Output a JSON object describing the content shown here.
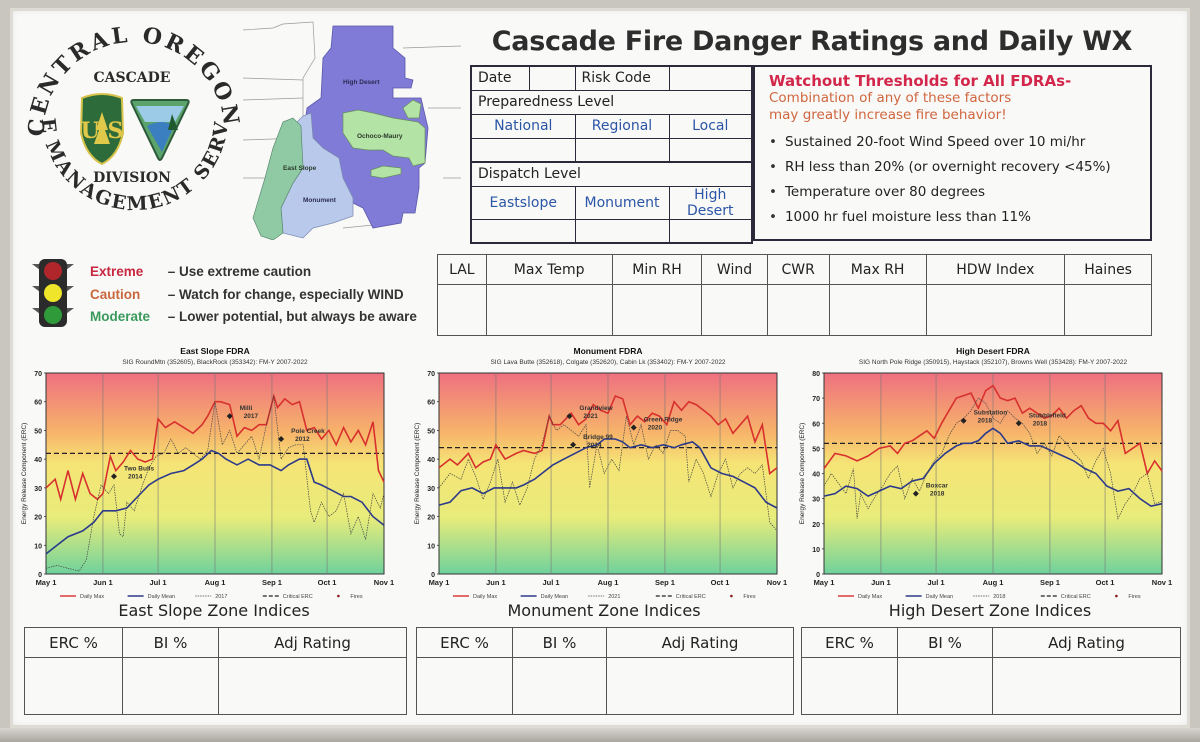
{
  "title": "Cascade Fire Danger Ratings and Daily WX",
  "logo": {
    "arc_top": "CENTRAL OREGON",
    "arc_bottom": "FIRE MANAGEMENT SERVICE",
    "line1": "CASCADE",
    "line2": "DIVISION",
    "usfs_badge": "FOREST SERVICE",
    "usfs_letters": "USFS",
    "blm_badge": "BUREAU OF LAND MANAGEMENT"
  },
  "map": {
    "regions": [
      {
        "name": "High Desert",
        "color": "#7d79d4"
      },
      {
        "name": "Ochoco-Maury",
        "color": "#b4e0a8"
      },
      {
        "name": "East Slope",
        "color": "#8ec9a4"
      },
      {
        "name": "Monument",
        "color": "#b7c8ea"
      }
    ]
  },
  "status_table": {
    "date_label": "Date",
    "date_value": "",
    "risk_code_label": "Risk Code",
    "risk_code_value": "",
    "preparedness_label": "Preparedness Level",
    "preparedness_cols": [
      "National",
      "Regional",
      "Local"
    ],
    "preparedness_values": [
      "",
      "",
      ""
    ],
    "dispatch_label": "Dispatch Level",
    "dispatch_cols": [
      "Eastslope",
      "Monument",
      "High Desert"
    ],
    "dispatch_values": [
      "",
      "",
      ""
    ]
  },
  "watchout": {
    "heading": "Watchout Thresholds for All FDRAs-",
    "subheading_1": "Combination of any of these factors",
    "subheading_2": "may greatly increase fire behavior!",
    "items": [
      "Sustained 20-foot Wind Speed over 10 mi/hr",
      "RH less than 20% (or overnight recovery <45%)",
      "Temperature over 80 degrees",
      "1000 hr fuel moisture less than 11%"
    ]
  },
  "legend": {
    "items": [
      {
        "level": "Extreme",
        "desc": "– Use extreme caution",
        "color": "#c8283f"
      },
      {
        "level": "Caution",
        "desc": "– Watch for change, especially WIND",
        "color": "#c9683d"
      },
      {
        "level": "Moderate",
        "desc": "– Lower potential, but always be aware",
        "color": "#3a9a5c"
      }
    ]
  },
  "wx_table": {
    "columns": [
      "LAL",
      "Max Temp",
      "Min RH",
      "Wind",
      "CWR",
      "Max RH",
      "HDW Index",
      "Haines"
    ],
    "values": [
      "",
      "",
      "",
      "",
      "",
      "",
      "",
      ""
    ]
  },
  "zones": [
    {
      "title": "East Slope Zone Indices",
      "columns": [
        "ERC %",
        "BI %",
        "Adj Rating"
      ],
      "values": [
        "",
        "",
        ""
      ]
    },
    {
      "title": "Monument Zone Indices",
      "columns": [
        "ERC %",
        "BI %",
        "Adj Rating"
      ],
      "values": [
        "",
        "",
        ""
      ]
    },
    {
      "title": "High Desert Zone Indices",
      "columns": [
        "ERC %",
        "BI %",
        "Adj Rating"
      ],
      "values": [
        "",
        "",
        ""
      ]
    }
  ],
  "chart_colors": {
    "daily_max": "#d8302e",
    "daily_mean": "#2c3a8c",
    "year": "#444444",
    "critical": "#222222"
  },
  "chart_data": [
    {
      "type": "line",
      "title": "East Slope FDRA",
      "subtitle": "SIG RoundMtn (352605), BlackRock (353342): FM-Y  2007-2022",
      "xlabel": "",
      "ylabel": "Energy Release Component (ERC)",
      "x_ticks": [
        "May 1",
        "Jun 1",
        "Jul 1",
        "Aug 1",
        "Sep 1",
        "Oct 1",
        "Nov 1"
      ],
      "x_range_days": [
        0,
        184
      ],
      "ylim": [
        0,
        70
      ],
      "y_ticks": [
        0,
        10,
        20,
        30,
        40,
        50,
        60,
        70
      ],
      "grid": "vertical at month starts",
      "legend": [
        "Daily Max",
        "Daily Mean",
        "2017",
        "Critical ERC",
        "Fires"
      ],
      "legend_placement": "bottom",
      "critical_erc": 42,
      "series": [
        {
          "name": "Daily Max",
          "x": [
            0,
            5,
            8,
            12,
            16,
            20,
            24,
            28,
            31,
            35,
            38,
            42,
            46,
            50,
            54,
            58,
            61,
            65,
            70,
            75,
            80,
            85,
            88,
            92,
            95,
            100,
            104,
            108,
            112,
            116,
            120,
            124,
            126,
            130,
            134,
            138,
            142,
            146,
            150,
            154,
            158,
            162,
            166,
            170,
            174,
            178,
            181,
            184
          ],
          "values": [
            30,
            33,
            26,
            36,
            26,
            35,
            28,
            26,
            28,
            41,
            36,
            39,
            43,
            40,
            39,
            40,
            54,
            51,
            53,
            51,
            49,
            52,
            55,
            60,
            60,
            59,
            48,
            51,
            50,
            52,
            52,
            62,
            58,
            61,
            59,
            60,
            50,
            51,
            47,
            50,
            45,
            51,
            46,
            50,
            45,
            53,
            36,
            32
          ]
        },
        {
          "name": "Daily Mean",
          "x": [
            0,
            6,
            12,
            20,
            26,
            31,
            38,
            44,
            50,
            56,
            61,
            68,
            75,
            80,
            85,
            90,
            94,
            98,
            104,
            110,
            116,
            122,
            128,
            132,
            138,
            142,
            146,
            150,
            156,
            162,
            166,
            172,
            178,
            184
          ],
          "values": [
            7,
            10,
            13,
            15,
            18,
            22,
            22,
            23,
            27,
            31,
            33,
            35,
            36,
            38,
            40,
            43,
            42,
            40,
            38,
            40,
            38,
            38,
            36,
            38,
            40,
            40,
            32,
            31,
            29,
            27,
            27,
            25,
            20,
            17
          ]
        },
        {
          "name": "2017",
          "x": [
            0,
            6,
            12,
            18,
            22,
            26,
            30,
            34,
            37,
            40,
            42,
            44,
            48,
            52,
            56,
            60,
            64,
            68,
            72,
            76,
            80,
            84,
            88,
            92,
            96,
            100,
            104,
            108,
            112,
            116,
            120,
            124,
            128,
            132,
            136,
            140,
            144,
            146,
            150,
            154,
            158,
            162,
            166,
            170,
            174,
            178,
            182,
            184
          ],
          "values": [
            2,
            3,
            2,
            1,
            5,
            20,
            31,
            28,
            31,
            14,
            13,
            25,
            22,
            30,
            37,
            41,
            42,
            47,
            42,
            44,
            42,
            40,
            43,
            60,
            45,
            50,
            42,
            45,
            48,
            40,
            52,
            62,
            40,
            44,
            45,
            45,
            22,
            18,
            25,
            20,
            22,
            28,
            14,
            20,
            12,
            28,
            23,
            28
          ]
        }
      ],
      "annotations": [
        {
          "label": "Two Bulls 2014",
          "x": 37,
          "y": 34
        },
        {
          "label": "Milli 2017",
          "x": 100,
          "y": 55
        },
        {
          "label": "Pole Creek 2012",
          "x": 128,
          "y": 47
        }
      ]
    },
    {
      "type": "line",
      "title": "Monument FDRA",
      "subtitle": "SIG Lava Butte (352618), Colgate (352620), Cabin Lk (353402): FM-Y    2007-2022",
      "xlabel": "",
      "ylabel": "Energy Release Component (ERC)",
      "x_ticks": [
        "May 1",
        "Jun 1",
        "Jul 1",
        "Aug 1",
        "Sep 1",
        "Oct 1",
        "Nov 1"
      ],
      "x_range_days": [
        0,
        184
      ],
      "ylim": [
        0,
        70
      ],
      "y_ticks": [
        0,
        10,
        20,
        30,
        40,
        50,
        60,
        70
      ],
      "grid": "vertical at month starts",
      "legend": [
        "Daily Max",
        "Daily Mean",
        "2021",
        "Critical ERC",
        "Fires"
      ],
      "legend_placement": "bottom",
      "critical_erc": 44,
      "series": [
        {
          "name": "Daily Max",
          "x": [
            0,
            6,
            10,
            16,
            20,
            24,
            28,
            31,
            36,
            42,
            46,
            52,
            56,
            60,
            62,
            66,
            72,
            76,
            80,
            84,
            88,
            92,
            96,
            100,
            104,
            108,
            112,
            116,
            120,
            124,
            128,
            132,
            136,
            140,
            144,
            148,
            152,
            156,
            160,
            164,
            168,
            172,
            176,
            180,
            184
          ],
          "values": [
            37,
            40,
            38,
            42,
            37,
            39,
            40,
            45,
            40,
            42,
            43,
            42,
            43,
            55,
            52,
            52,
            56,
            52,
            54,
            59,
            57,
            56,
            62,
            61,
            52,
            55,
            53,
            56,
            55,
            52,
            60,
            57,
            60,
            59,
            57,
            55,
            52,
            54,
            49,
            52,
            55,
            46,
            52,
            35,
            37
          ]
        },
        {
          "name": "Daily Mean",
          "x": [
            0,
            6,
            12,
            18,
            24,
            30,
            36,
            42,
            46,
            52,
            58,
            62,
            68,
            74,
            80,
            86,
            90,
            96,
            100,
            104,
            110,
            116,
            122,
            128,
            132,
            138,
            142,
            148,
            154,
            160,
            166,
            172,
            178,
            184
          ],
          "values": [
            24,
            25,
            29,
            30,
            28,
            30,
            30,
            30,
            31,
            33,
            36,
            38,
            40,
            42,
            44,
            45,
            47,
            47,
            46,
            44,
            45,
            44,
            45,
            44,
            45,
            46,
            44,
            37,
            35,
            34,
            32,
            30,
            25,
            23
          ]
        },
        {
          "name": "2021",
          "x": [
            0,
            6,
            12,
            16,
            20,
            24,
            28,
            32,
            36,
            40,
            44,
            48,
            52,
            56,
            60,
            64,
            68,
            72,
            76,
            80,
            82,
            86,
            90,
            94,
            98,
            102,
            106,
            110,
            114,
            118,
            122,
            126,
            130,
            134,
            136,
            140,
            144,
            148,
            152,
            156,
            160,
            164,
            168,
            172,
            176,
            180,
            184
          ],
          "values": [
            30,
            35,
            33,
            40,
            34,
            26,
            32,
            40,
            25,
            32,
            24,
            30,
            40,
            45,
            55,
            50,
            52,
            50,
            48,
            52,
            30,
            45,
            35,
            40,
            36,
            55,
            45,
            52,
            40,
            45,
            42,
            50,
            50,
            48,
            32,
            40,
            35,
            27,
            35,
            40,
            30,
            35,
            37,
            35,
            38,
            18,
            15
          ]
        }
      ],
      "annotations": [
        {
          "label": "Grandview 2021",
          "x": 71,
          "y": 55
        },
        {
          "label": "Bridge 99 2014",
          "x": 73,
          "y": 45
        },
        {
          "label": "Green Ridge 2020",
          "x": 106,
          "y": 51
        }
      ]
    },
    {
      "type": "line",
      "title": "High Desert FDRA",
      "subtitle": "SIG North Pole Ridge (350915),  Haystack (352107),  Browns Well (353428):  FM-Y   2007-2022",
      "xlabel": "",
      "ylabel": "Energy Release Component (ERC)",
      "x_ticks": [
        "May 1",
        "Jun 1",
        "Jul 1",
        "Aug 1",
        "Sep 1",
        "Oct 1",
        "Nov 1"
      ],
      "x_range_days": [
        0,
        184
      ],
      "ylim": [
        0,
        80
      ],
      "y_ticks": [
        0,
        10,
        20,
        30,
        40,
        50,
        60,
        70,
        80
      ],
      "grid": "vertical at month starts",
      "legend": [
        "Daily Max",
        "Daily Mean",
        "2018",
        "Critical ERC",
        "Fires"
      ],
      "legend_placement": "bottom",
      "critical_erc": 52,
      "series": [
        {
          "name": "Daily Max",
          "x": [
            0,
            6,
            12,
            18,
            24,
            30,
            36,
            40,
            44,
            48,
            52,
            56,
            60,
            64,
            68,
            72,
            76,
            80,
            84,
            88,
            92,
            96,
            100,
            104,
            108,
            112,
            116,
            120,
            124,
            128,
            132,
            136,
            140,
            144,
            148,
            152,
            156,
            160,
            164,
            168,
            172,
            176,
            180,
            184
          ],
          "values": [
            42,
            48,
            47,
            45,
            47,
            50,
            51,
            48,
            52,
            53,
            55,
            57,
            54,
            60,
            65,
            70,
            71,
            72,
            66,
            73,
            75,
            70,
            69,
            70,
            64,
            66,
            64,
            62,
            63,
            66,
            62,
            65,
            67,
            62,
            60,
            60,
            57,
            61,
            48,
            50,
            52,
            40,
            45,
            41
          ]
        },
        {
          "name": "Daily Mean",
          "x": [
            0,
            6,
            12,
            18,
            24,
            30,
            36,
            42,
            48,
            54,
            60,
            66,
            72,
            76,
            80,
            84,
            88,
            92,
            96,
            100,
            106,
            112,
            118,
            124,
            130,
            136,
            142,
            148,
            154,
            160,
            166,
            172,
            178,
            184
          ],
          "values": [
            31,
            32,
            35,
            34,
            31,
            33,
            35,
            34,
            37,
            38,
            44,
            48,
            51,
            52,
            52,
            53,
            56,
            58,
            56,
            52,
            53,
            51,
            51,
            49,
            47,
            45,
            42,
            40,
            35,
            33,
            34,
            30,
            27,
            28
          ]
        },
        {
          "name": "2018",
          "x": [
            0,
            4,
            8,
            12,
            16,
            18,
            20,
            24,
            28,
            32,
            36,
            40,
            44,
            48,
            52,
            56,
            60,
            64,
            68,
            72,
            76,
            80,
            84,
            88,
            92,
            96,
            100,
            104,
            108,
            112,
            116,
            120,
            124,
            128,
            132,
            136,
            140,
            144,
            148,
            152,
            156,
            160,
            164,
            168,
            172,
            176,
            180,
            184
          ],
          "values": [
            35,
            40,
            36,
            32,
            42,
            22,
            32,
            26,
            31,
            35,
            40,
            43,
            30,
            38,
            33,
            40,
            45,
            48,
            55,
            60,
            62,
            65,
            70,
            68,
            62,
            60,
            65,
            62,
            60,
            56,
            48,
            52,
            47,
            55,
            52,
            48,
            45,
            38,
            45,
            50,
            40,
            22,
            28,
            32,
            38,
            40,
            28,
            29
          ]
        }
      ],
      "annotations": [
        {
          "label": "Substation 2018",
          "x": 76,
          "y": 61
        },
        {
          "label": "Stubblefield 2018",
          "x": 106,
          "y": 60
        },
        {
          "label": "Boxcar 2018",
          "x": 50,
          "y": 32
        }
      ]
    }
  ]
}
